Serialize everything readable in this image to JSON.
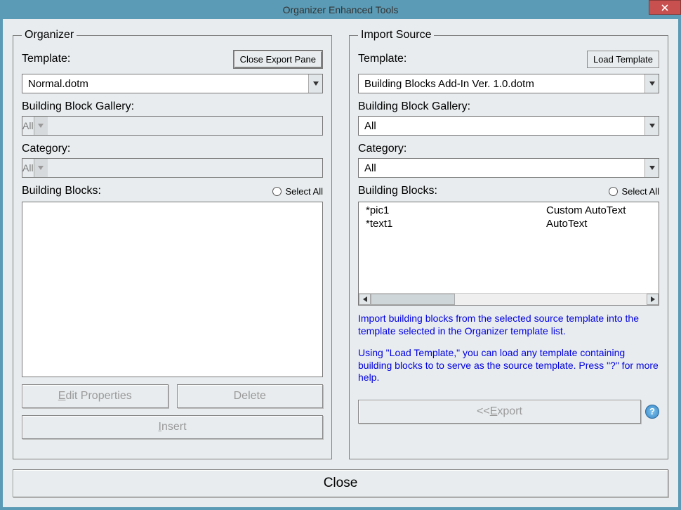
{
  "window": {
    "title": "Organizer Enhanced Tools"
  },
  "organizer": {
    "legend": "Organizer",
    "template_label": "Template:",
    "close_export_btn": "Close Export Pane",
    "template_value": "Normal.dotm",
    "gallery_label": "Building Block Gallery:",
    "gallery_value": "All",
    "category_label": "Category:",
    "category_value": "All",
    "blocks_label": "Building Blocks:",
    "select_all": "Select All",
    "edit_btn_prefix": "E",
    "edit_btn_rest": "dit Properties",
    "delete_btn": "Delete",
    "insert_btn_prefix": "I",
    "insert_btn_rest": "nsert"
  },
  "import": {
    "legend": "Import Source",
    "template_label": "Template:",
    "load_btn": "Load Template",
    "template_value": "Building Blocks Add-In Ver. 1.0.dotm",
    "gallery_label": "Building Block Gallery:",
    "gallery_value": "All",
    "category_label": "Category:",
    "category_value": "All",
    "blocks_label": "Building Blocks:",
    "select_all": "Select All",
    "items": [
      {
        "name": "*pic1",
        "type": "Custom AutoText"
      },
      {
        "name": "*text1",
        "type": "AutoText"
      }
    ],
    "note1": "Import building blocks from the selected source template into the template selected in the Organizer template list.",
    "note2": "Using \"Load Template,\" you can load any template containing building blocks to to serve as the source template. Press \"?\" for more help.",
    "export_prefix": "<<",
    "export_accel": "E",
    "export_rest": "xport",
    "help": "?"
  },
  "footer": {
    "close": "Close"
  }
}
